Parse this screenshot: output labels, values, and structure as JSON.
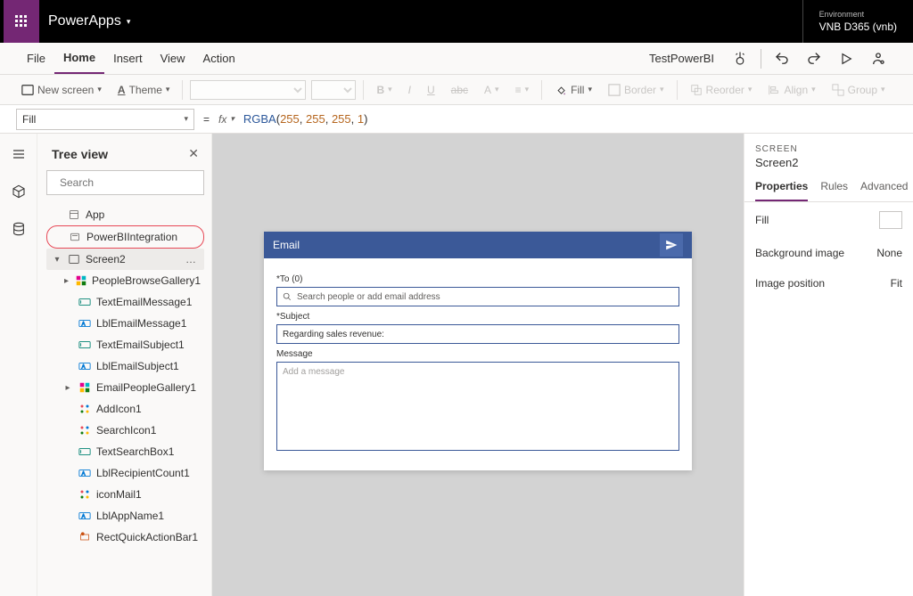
{
  "header": {
    "app_name": "PowerApps",
    "env_label": "Environment",
    "env_name": "VNB D365 (vnb)"
  },
  "menu": {
    "file": "File",
    "home": "Home",
    "insert": "Insert",
    "view": "View",
    "action": "Action",
    "document_name": "TestPowerBI"
  },
  "ribbon": {
    "new_screen": "New screen",
    "theme": "Theme",
    "fill": "Fill",
    "border": "Border",
    "reorder": "Reorder",
    "align": "Align",
    "group": "Group"
  },
  "formula": {
    "property": "Fill",
    "fx": "fx",
    "fn": "RGBA",
    "args": [
      "255",
      "255",
      "255",
      "1"
    ]
  },
  "tree": {
    "title": "Tree view",
    "search_placeholder": "Search",
    "items": [
      {
        "label": "App"
      },
      {
        "label": "PowerBIIntegration"
      },
      {
        "label": "Screen2"
      },
      {
        "label": "PeopleBrowseGallery1"
      },
      {
        "label": "TextEmailMessage1"
      },
      {
        "label": "LblEmailMessage1"
      },
      {
        "label": "TextEmailSubject1"
      },
      {
        "label": "LblEmailSubject1"
      },
      {
        "label": "EmailPeopleGallery1"
      },
      {
        "label": "AddIcon1"
      },
      {
        "label": "SearchIcon1"
      },
      {
        "label": "TextSearchBox1"
      },
      {
        "label": "LblRecipientCount1"
      },
      {
        "label": "iconMail1"
      },
      {
        "label": "LblAppName1"
      },
      {
        "label": "RectQuickActionBar1"
      }
    ]
  },
  "canvas": {
    "email_title": "Email",
    "to_label": "*To (0)",
    "to_placeholder": "Search people or add email address",
    "subject_label": "*Subject",
    "subject_value": "Regarding sales revenue:",
    "message_label": "Message",
    "message_placeholder": "Add a message"
  },
  "props": {
    "section_label": "SCREEN",
    "screen_name": "Screen2",
    "tabs": {
      "properties": "Properties",
      "rules": "Rules",
      "advanced": "Advanced"
    },
    "rows": {
      "fill": "Fill",
      "bg_image": "Background image",
      "bg_image_val": "None",
      "img_pos": "Image position",
      "img_pos_val": "Fit"
    }
  }
}
